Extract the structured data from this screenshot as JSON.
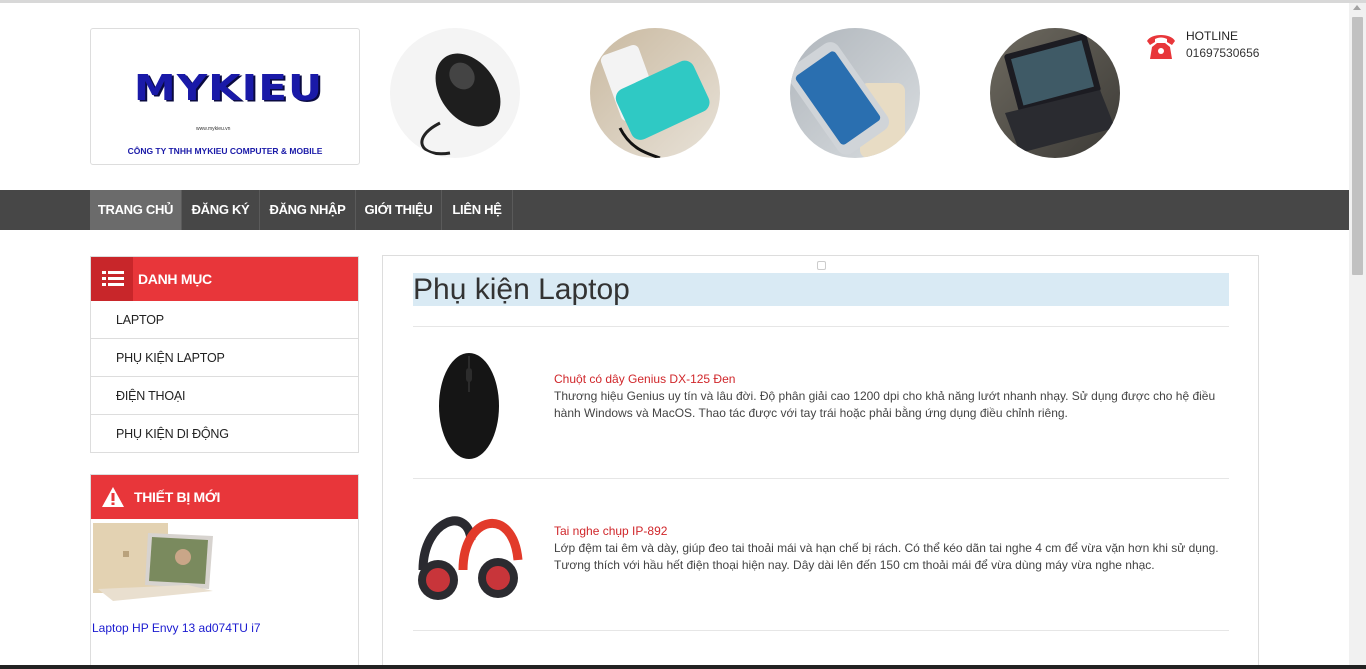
{
  "logo": {
    "name": "MYKIEU",
    "url": "www.mykieu.vn",
    "company": "CÔNG TY TNHH MYKIEU COMPUTER & MOBILE"
  },
  "banner_icons": [
    "mouse-icon",
    "power-bank-icon",
    "smartphone-icon",
    "laptop-icon"
  ],
  "hotline": {
    "label": "HOTLINE",
    "number": "01697530656"
  },
  "nav": {
    "items": [
      {
        "label": "TRANG CHỦ"
      },
      {
        "label": "ĐĂNG KÝ"
      },
      {
        "label": "ĐĂNG NHẬP"
      },
      {
        "label": "GIỚI THIỆU"
      },
      {
        "label": "LIÊN HỆ"
      }
    ]
  },
  "sidebar": {
    "category": {
      "title": "DANH MỤC",
      "items": [
        {
          "label": "LAPTOP"
        },
        {
          "label": "PHỤ KIỆN LAPTOP"
        },
        {
          "label": "ĐIỆN THOẠI"
        },
        {
          "label": "PHỤ KIỆN DI ĐỘNG"
        }
      ]
    },
    "new_devices": {
      "title": "THIẾT BỊ MỚI",
      "items": [
        {
          "name": "Laptop HP Envy 13 ad074TU i7"
        }
      ]
    }
  },
  "main": {
    "title": "Phụ kiện Laptop",
    "products": [
      {
        "name": "Chuột có dây Genius DX-125 Đen",
        "description": "Thương hiệu Genius uy tín và lâu đời. Độ phân giải cao 1200 dpi cho khả năng lướt nhanh nhạy. Sử dụng được cho hệ điều hành Windows và MacOS. Thao tác được với tay trái hoặc phải bằng ứng dụng điều chỉnh riêng."
      },
      {
        "name": "Tai nghe chụp IP-892",
        "description": "Lớp đệm tai êm và dày, giúp đeo tai thoải mái và hạn chế bị rách. Có thể kéo dãn tai nghe 4 cm để vừa vặn hơn khi sử dụng. Tương thích với hầu hết điện thoại hiện nay. Dây dài lên đến 150 cm thoải mái để vừa dùng máy vừa nghe nhạc."
      }
    ]
  },
  "colors": {
    "accent_red": "#e8363a",
    "nav_bg": "#474747",
    "title_bg": "#d9eaf4",
    "link_blue": "#1a1ad0"
  }
}
